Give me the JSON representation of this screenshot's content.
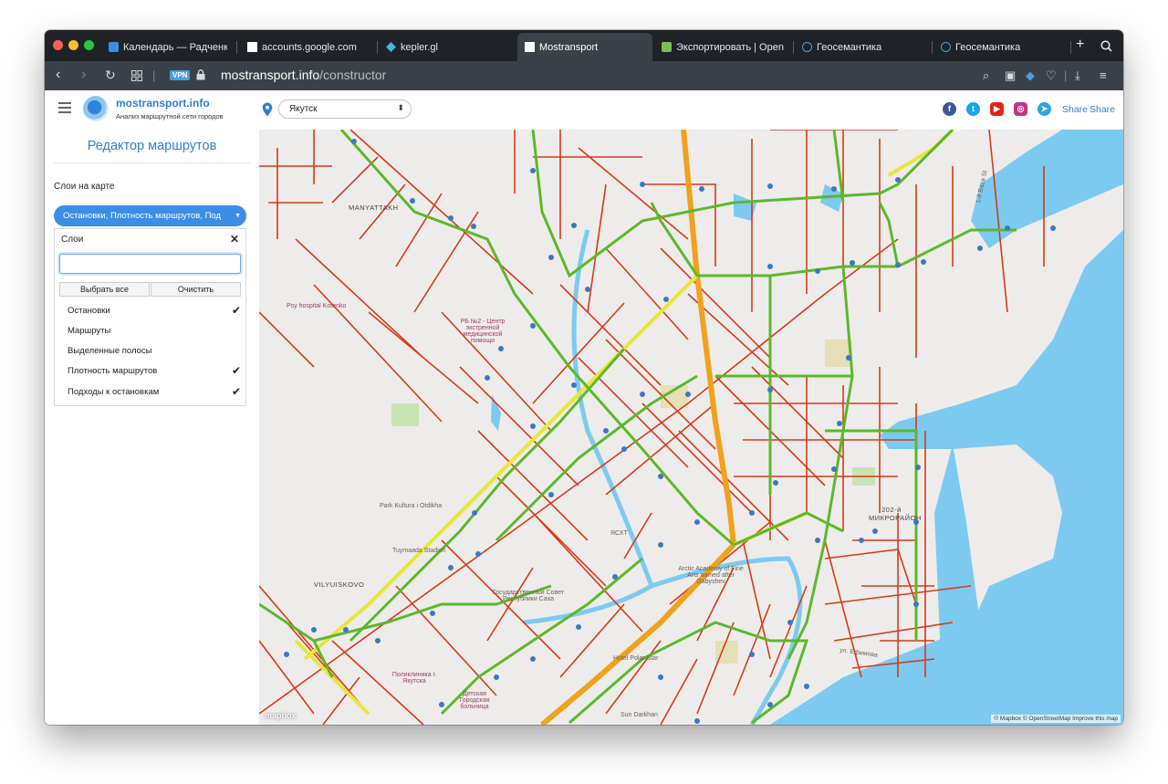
{
  "browser": {
    "tabs": [
      {
        "title": "Календарь — Радченко А",
        "icon_color": "#3a8ee6"
      },
      {
        "title": "accounts.google.com",
        "icon_color": "#ffffff"
      },
      {
        "title": "kepler.gl",
        "icon_color": "#4fb3d9"
      },
      {
        "title": "Mostransport",
        "icon_color": "#ffffff"
      },
      {
        "title": "Экспортировать | OpenSt",
        "icon_color": "#7ebc59"
      },
      {
        "title": "Геосемантика",
        "icon_color": "#4a9fd8"
      },
      {
        "title": "Геосемантика",
        "icon_color": "#4a9fd8"
      }
    ],
    "active_tab": 3,
    "vpn_label": "VPN",
    "url_host": "mostransport.info",
    "url_path": "/constructor"
  },
  "header": {
    "brand": "mostransport.info",
    "subtitle": "Анализ маршрутной сети городов",
    "city": "Якутск",
    "share_labels": [
      "Share",
      "Share"
    ],
    "social_colors": {
      "facebook": "#3b5998",
      "twitter": "#1da1f2",
      "youtube": "#e62117",
      "instagram": "#c13584",
      "telegram": "#2ca5e0"
    }
  },
  "sidebar": {
    "title": "Редактор маршрутов",
    "layers_label": "Слои на карте",
    "layers_button": "Остановки, Плотность маршрутов, Под",
    "dropdown": {
      "title": "Слои",
      "search_value": "",
      "select_all": "Выбрать все",
      "clear": "Очистить",
      "items": [
        {
          "label": "Остановки",
          "checked": true
        },
        {
          "label": "Маршруты",
          "checked": false
        },
        {
          "label": "Выделенные полосы",
          "checked": false
        },
        {
          "label": "Плотность маршрутов",
          "checked": true
        },
        {
          "label": "Подходы к остановкам",
          "checked": true
        }
      ]
    }
  },
  "map": {
    "labels": [
      "MANYATTAKH",
      "VILYUISKOVO",
      "Psy hospital Kotenko",
      "РБ №2 - Центр экстренной медицинской помощи",
      "Park Kultura i Otdikha",
      "Tuymaada Stadion",
      "ЯСХТ",
      "Государственный Совет Республики Саха",
      "Hotel Polar Star",
      "Sun Darkhan",
      "202-й МИКРОРАЙОН",
      "Детская Городская больница",
      "Поликлиника г. Якутска",
      "Arctic Academy of Fine Arts named after Gabyshev",
      "1-й Baza St",
      "ул. Ефимова"
    ],
    "mapbox_text": "mapbox",
    "attribution": "© Mapbox © OpenStreetMap Improve this map",
    "colors": {
      "water": "#7dcaf0",
      "park": "#c8e3b4",
      "local_route": "#d63a17",
      "trunk_route": "#f0a21c",
      "medium_route": "#e9e63c",
      "green_route": "#5cb82a",
      "stop": "#3d78bf"
    }
  }
}
